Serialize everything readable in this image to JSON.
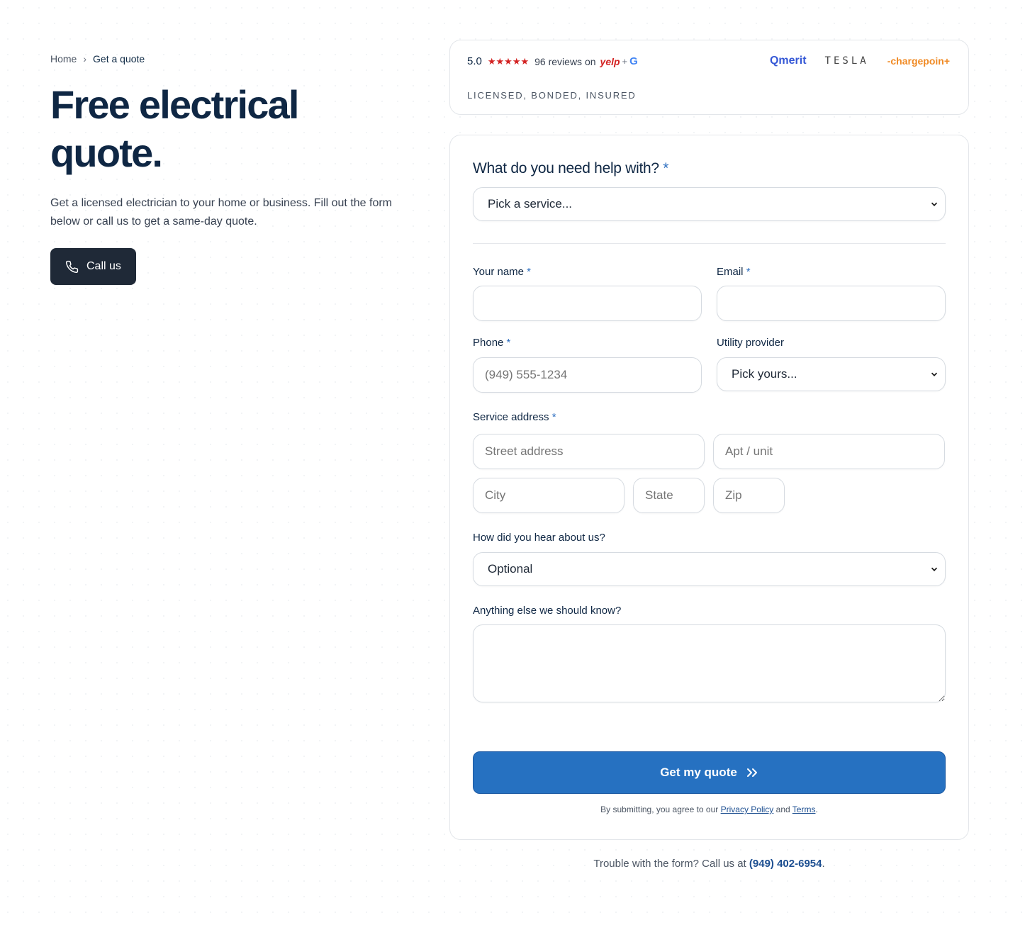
{
  "breadcrumb": {
    "home": "Home",
    "separator": "›",
    "current": "Get a quote"
  },
  "hero": {
    "title": "Free electrical quote.",
    "intro": "Get a licensed electrician to your home or business. Fill out the form below or call us to get a same-day quote.",
    "call_label": "Call us"
  },
  "trust": {
    "score": "5.0",
    "stars": "★★★★★",
    "reviews": "96 reviews on",
    "yelp": "yelp",
    "plus": "+",
    "google": "G",
    "licensed": "LICENSED, BONDED, INSURED",
    "logos": {
      "qmerit": "Qmerit",
      "tesla": "TESLA",
      "chargepoint": "-chargepoin+"
    }
  },
  "form": {
    "question": "What do you need help with?",
    "required_mark": "*",
    "service_select": "Pick a service...",
    "name_label": "Your name",
    "email_label": "Email",
    "phone_label": "Phone",
    "phone_placeholder": "(949) 555-1234",
    "utility_label": "Utility provider",
    "utility_select": "Pick yours...",
    "address_label": "Service address",
    "street_placeholder": "Street address",
    "apt_placeholder": "Apt / unit",
    "city_placeholder": "City",
    "state_placeholder": "State",
    "zip_placeholder": "Zip",
    "hear_label": "How did you hear about us?",
    "hear_select": "Optional",
    "notes_label": "Anything else we should know?",
    "submit_label": "Get my quote",
    "agree_prefix": "By submitting, you agree to our",
    "privacy_link": "Privacy Policy",
    "agree_and": "and",
    "terms_link": "Terms",
    "agree_suffix": "."
  },
  "footer": {
    "trouble_text": "Trouble with the form? Call us at",
    "phone": "(949) 402-6954",
    "suffix": "."
  },
  "colors": {
    "primary": "#2671c1",
    "dark": "#1f2937",
    "heading": "#0f2744",
    "yelp": "#d32323"
  }
}
